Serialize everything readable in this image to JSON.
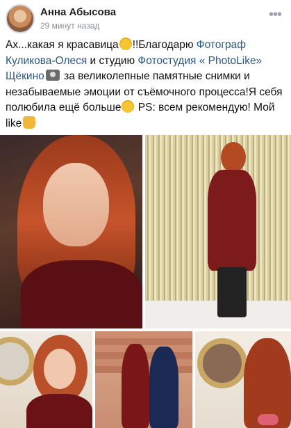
{
  "post": {
    "author": "Анна Абысова",
    "time": "29 минут назад",
    "text": {
      "t1": "Ах...какая я красавица",
      "t2": "!!Благодарю ",
      "link1": "Фотограф Куликова-Олеся",
      "t3": " и студию ",
      "link2": "Фотостудия « PhotoLike» Щёкино",
      "t4": " за великолепные памятные снимки и незабываемые эмоции от съёмочного процесса!Я себя полюбила ещё больше",
      "t5": " PS: всем рекомендую!  Мой like"
    }
  },
  "icons": {
    "more": "ellipsis-icon",
    "emoji_heart_eyes": "heart-eyes-emoji",
    "emoji_camera": "camera-flash-emoji",
    "emoji_star_eyes": "star-struck-emoji",
    "emoji_thumb": "thumbs-up-emoji"
  },
  "colors": {
    "link": "#2a5885",
    "name": "#222222",
    "time": "#8b8f96"
  }
}
